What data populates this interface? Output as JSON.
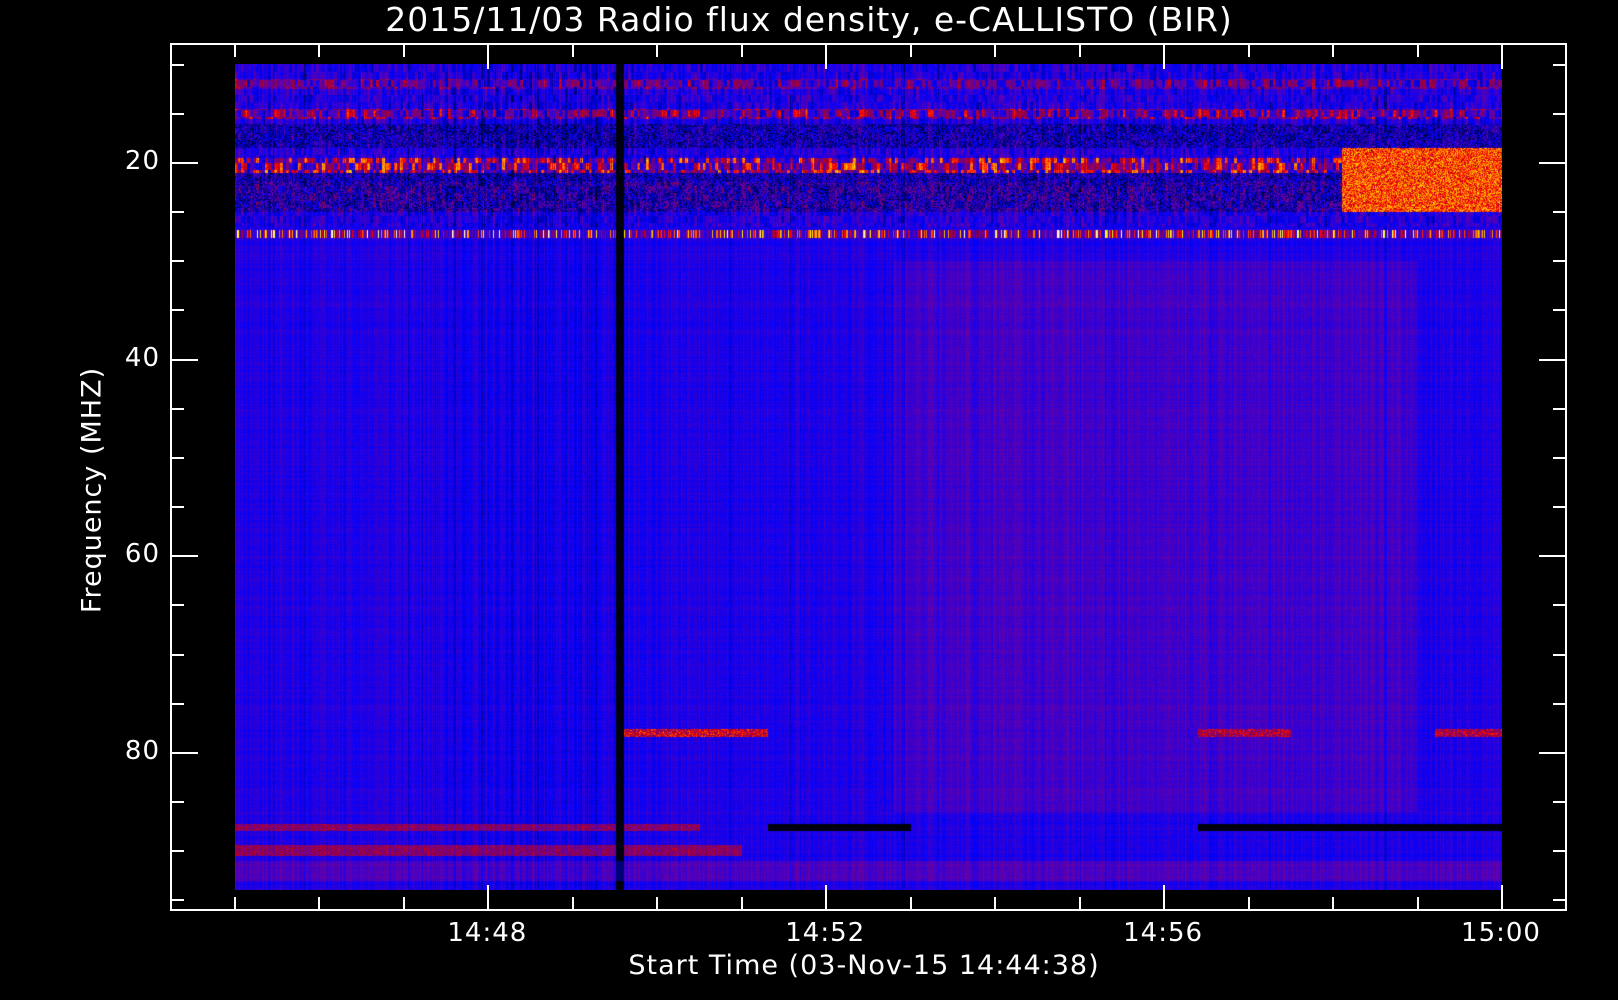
{
  "chart_data": {
    "type": "heatmap",
    "title": "2015/11/03  Radio flux density, e-CALLISTO (BIR)",
    "xlabel": "Start Time (03-Nov-15 14:44:38)",
    "ylabel": "Frequency (MHZ)",
    "x_unit": "minutes after 14:00 UT",
    "xlim": [
      44.25,
      60.8
    ],
    "ylim": [
      96.2,
      7.9
    ],
    "data_time_range": [
      45.0,
      60.0
    ],
    "data_freq_range": [
      10,
      94
    ],
    "x_major_ticks": [
      {
        "value": 48,
        "label": "14:48"
      },
      {
        "value": 52,
        "label": "14:52"
      },
      {
        "value": 56,
        "label": "14:56"
      },
      {
        "value": 60,
        "label": "15:00"
      }
    ],
    "x_minor_tick_step": 1,
    "y_major_ticks": [
      {
        "value": 20,
        "label": "20"
      },
      {
        "value": 40,
        "label": "40"
      },
      {
        "value": 60,
        "label": "60"
      },
      {
        "value": 80,
        "label": "80"
      }
    ],
    "y_minor_tick_step": 5,
    "colormap": [
      "#000000",
      "#0000ff",
      "#6400aa",
      "#96003c",
      "#ff0000",
      "#ff9600",
      "#ffff00",
      "#ffffff"
    ],
    "features": [
      {
        "kind": "rfi-band",
        "freq": [
          19.5,
          21
        ],
        "time": [
          45,
          60
        ],
        "level": 0.7
      },
      {
        "kind": "rfi-band",
        "freq": [
          14.5,
          15.5
        ],
        "time": [
          45,
          60
        ],
        "level": 0.55
      },
      {
        "kind": "rfi-band",
        "freq": [
          26.8,
          27.6
        ],
        "time": [
          45,
          60
        ],
        "level": 0.6
      },
      {
        "kind": "burst",
        "freq": [
          18.5,
          25
        ],
        "time": [
          58.1,
          60
        ],
        "level": 0.65
      },
      {
        "kind": "burst",
        "freq": [
          77.6,
          78.4
        ],
        "time": [
          49.6,
          51.3
        ],
        "level": 0.5
      },
      {
        "kind": "burst",
        "freq": [
          77.6,
          78.4
        ],
        "time": [
          56.4,
          57.5
        ],
        "level": 0.45
      },
      {
        "kind": "burst",
        "freq": [
          77.6,
          78.4
        ],
        "time": [
          59.2,
          60
        ],
        "level": 0.45
      },
      {
        "kind": "rfi-band",
        "freq": [
          87.2,
          87.9
        ],
        "time": [
          45,
          50.5
        ],
        "level": 0.45
      },
      {
        "kind": "dropout",
        "freq": [
          87.2,
          87.9
        ],
        "time": [
          51.3,
          53
        ],
        "level": 0.0
      },
      {
        "kind": "dropout",
        "freq": [
          87.2,
          87.9
        ],
        "time": [
          56.4,
          60
        ],
        "level": 0.0
      },
      {
        "kind": "rfi-band",
        "freq": [
          89.4,
          90.5
        ],
        "time": [
          45,
          51
        ],
        "level": 0.45
      },
      {
        "kind": "dropout-column",
        "freq": [
          10,
          94
        ],
        "time": [
          49.5,
          49.6
        ],
        "level": 0.0
      }
    ]
  }
}
